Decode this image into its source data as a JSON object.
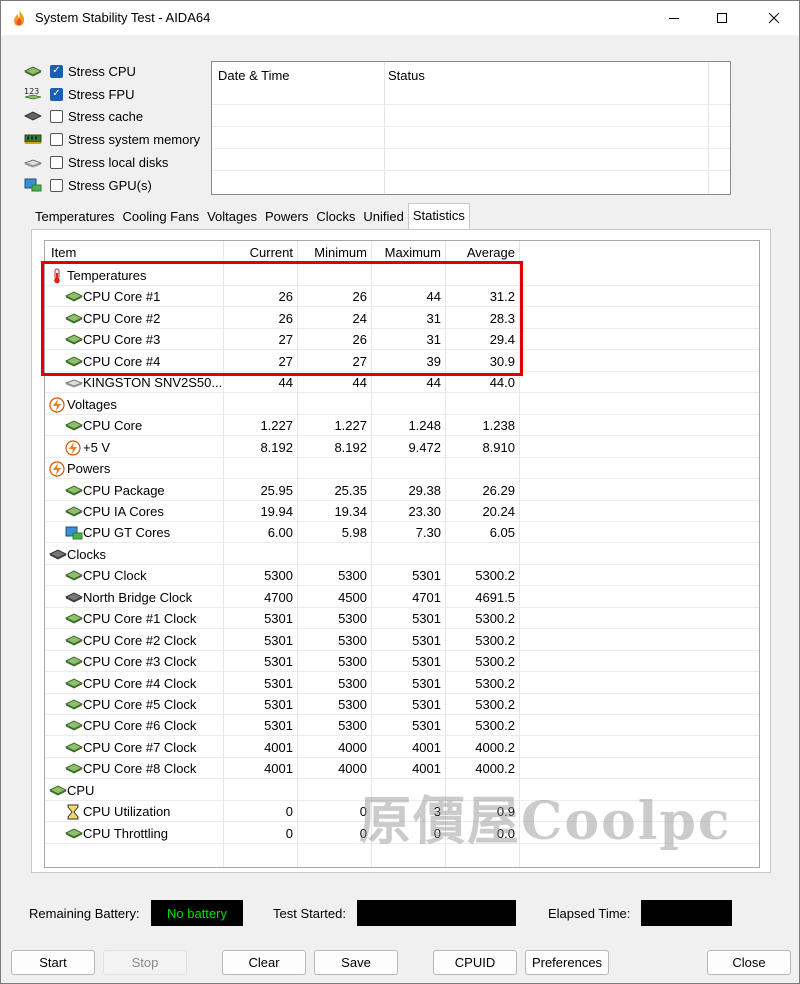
{
  "window": {
    "title": "System Stability Test - AIDA64"
  },
  "stress": [
    {
      "label": "Stress CPU",
      "checked": true,
      "icon": "cpu-chip-icon"
    },
    {
      "label": "Stress FPU",
      "checked": true,
      "icon": "fpu-123-icon"
    },
    {
      "label": "Stress cache",
      "checked": false,
      "icon": "cache-chip-icon"
    },
    {
      "label": "Stress system memory",
      "checked": false,
      "icon": "memory-module-icon"
    },
    {
      "label": "Stress local disks",
      "checked": false,
      "icon": "disk-drive-icon"
    },
    {
      "label": "Stress GPU(s)",
      "checked": false,
      "icon": "gpu-card-icon"
    }
  ],
  "log": {
    "col_date": "Date & Time",
    "col_status": "Status"
  },
  "tabs": [
    "Temperatures",
    "Cooling Fans",
    "Voltages",
    "Powers",
    "Clocks",
    "Unified",
    "Statistics"
  ],
  "active_tab": "Statistics",
  "table": {
    "headers": {
      "item": "Item",
      "current": "Current",
      "minimum": "Minimum",
      "maximum": "Maximum",
      "average": "Average"
    },
    "rows": [
      {
        "group": true,
        "icon": "thermometer-icon",
        "name": "Temperatures"
      },
      {
        "group": false,
        "icon": "cpu-chip-icon",
        "name": "CPU Core #1",
        "cur": "26",
        "min": "26",
        "max": "44",
        "avg": "31.2"
      },
      {
        "group": false,
        "icon": "cpu-chip-icon",
        "name": "CPU Core #2",
        "cur": "26",
        "min": "24",
        "max": "31",
        "avg": "28.3"
      },
      {
        "group": false,
        "icon": "cpu-chip-icon",
        "name": "CPU Core #3",
        "cur": "27",
        "min": "26",
        "max": "31",
        "avg": "29.4"
      },
      {
        "group": false,
        "icon": "cpu-chip-icon",
        "name": "CPU Core #4",
        "cur": "27",
        "min": "27",
        "max": "39",
        "avg": "30.9"
      },
      {
        "group": false,
        "icon": "disk-drive-icon",
        "name": "KINGSTON SNV2S50...",
        "cur": "44",
        "min": "44",
        "max": "44",
        "avg": "44.0"
      },
      {
        "group": true,
        "icon": "voltage-bolt-icon",
        "name": "Voltages"
      },
      {
        "group": false,
        "icon": "cpu-chip-icon",
        "name": "CPU Core",
        "cur": "1.227",
        "min": "1.227",
        "max": "1.248",
        "avg": "1.238"
      },
      {
        "group": false,
        "icon": "voltage-bolt-icon",
        "name": "+5 V",
        "cur": "8.192",
        "min": "8.192",
        "max": "9.472",
        "avg": "8.910"
      },
      {
        "group": true,
        "icon": "voltage-bolt-icon",
        "name": "Powers"
      },
      {
        "group": false,
        "icon": "cpu-chip-icon",
        "name": "CPU Package",
        "cur": "25.95",
        "min": "25.35",
        "max": "29.38",
        "avg": "26.29"
      },
      {
        "group": false,
        "icon": "cpu-chip-icon",
        "name": "CPU IA Cores",
        "cur": "19.94",
        "min": "19.34",
        "max": "23.30",
        "avg": "20.24"
      },
      {
        "group": false,
        "icon": "gpu-card-icon",
        "name": "CPU GT Cores",
        "cur": "6.00",
        "min": "5.98",
        "max": "7.30",
        "avg": "6.05"
      },
      {
        "group": true,
        "icon": "clock-chip-icon",
        "name": "Clocks"
      },
      {
        "group": false,
        "icon": "cpu-chip-icon",
        "name": "CPU Clock",
        "cur": "5300",
        "min": "5300",
        "max": "5301",
        "avg": "5300.2"
      },
      {
        "group": false,
        "icon": "clock-chip-icon",
        "name": "North Bridge Clock",
        "cur": "4700",
        "min": "4500",
        "max": "4701",
        "avg": "4691.5"
      },
      {
        "group": false,
        "icon": "cpu-chip-icon",
        "name": "CPU Core #1 Clock",
        "cur": "5301",
        "min": "5300",
        "max": "5301",
        "avg": "5300.2"
      },
      {
        "group": false,
        "icon": "cpu-chip-icon",
        "name": "CPU Core #2 Clock",
        "cur": "5301",
        "min": "5300",
        "max": "5301",
        "avg": "5300.2"
      },
      {
        "group": false,
        "icon": "cpu-chip-icon",
        "name": "CPU Core #3 Clock",
        "cur": "5301",
        "min": "5300",
        "max": "5301",
        "avg": "5300.2"
      },
      {
        "group": false,
        "icon": "cpu-chip-icon",
        "name": "CPU Core #4 Clock",
        "cur": "5301",
        "min": "5300",
        "max": "5301",
        "avg": "5300.2"
      },
      {
        "group": false,
        "icon": "cpu-chip-icon",
        "name": "CPU Core #5 Clock",
        "cur": "5301",
        "min": "5300",
        "max": "5301",
        "avg": "5300.2"
      },
      {
        "group": false,
        "icon": "cpu-chip-icon",
        "name": "CPU Core #6 Clock",
        "cur": "5301",
        "min": "5300",
        "max": "5301",
        "avg": "5300.2"
      },
      {
        "group": false,
        "icon": "cpu-chip-icon",
        "name": "CPU Core #7 Clock",
        "cur": "4001",
        "min": "4000",
        "max": "4001",
        "avg": "4000.2"
      },
      {
        "group": false,
        "icon": "cpu-chip-icon",
        "name": "CPU Core #8 Clock",
        "cur": "4001",
        "min": "4000",
        "max": "4001",
        "avg": "4000.2"
      },
      {
        "group": true,
        "icon": "cpu-chip-icon",
        "name": "CPU"
      },
      {
        "group": false,
        "icon": "hourglass-icon",
        "name": "CPU Utilization",
        "cur": "0",
        "min": "0",
        "max": "3",
        "avg": "0.9"
      },
      {
        "group": false,
        "icon": "cpu-chip-icon",
        "name": "CPU Throttling",
        "cur": "0",
        "min": "0",
        "max": "0",
        "avg": "0.0"
      }
    ]
  },
  "status": {
    "battery_label": "Remaining Battery:",
    "battery_value": "No battery",
    "test_started_label": "Test Started:",
    "elapsed_label": "Elapsed Time:"
  },
  "buttons": {
    "start": "Start",
    "stop": "Stop",
    "clear": "Clear",
    "save": "Save",
    "cpuid": "CPUID",
    "preferences": "Preferences",
    "close": "Close"
  },
  "watermark": "原價屋Coolpc",
  "colors": {
    "highlight": "#e00000",
    "battery_text": "#00e000",
    "checkbox_accent": "#1a5fb4"
  }
}
